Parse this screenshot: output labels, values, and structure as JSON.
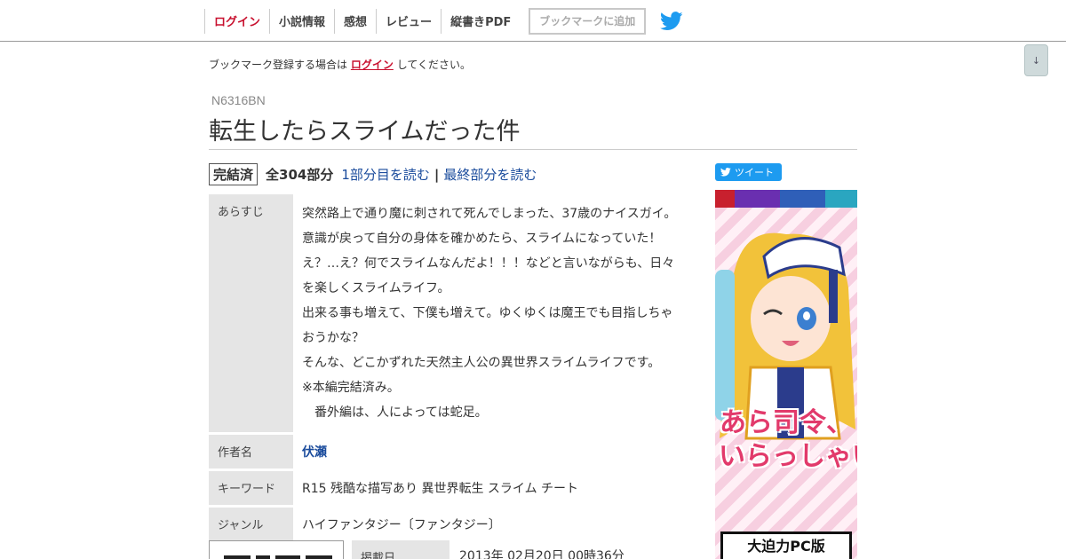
{
  "nav": {
    "items": [
      {
        "label": "ログイン",
        "kind": "login"
      },
      {
        "label": "小説情報"
      },
      {
        "label": "感想"
      },
      {
        "label": "レビュー"
      },
      {
        "label": "縦書きPDF"
      }
    ],
    "bookmark_label": "ブックマークに追加",
    "twitter_icon": "twitter-bird-icon",
    "twitter_color": "#1d9bf0"
  },
  "scroll_button": "↓",
  "notice": {
    "before": "ブックマーク登録する場合は",
    "link": "ログイン",
    "after": "してください。"
  },
  "novel": {
    "ncode": "N6316BN",
    "title": "転生したらスライムだった件",
    "status": "完結済",
    "total": "全304部分",
    "read_first": "1部分目を読む",
    "separator": "|",
    "read_last": "最終部分を読む"
  },
  "info": {
    "summary_label": "あらすじ",
    "summary_lines": [
      "突然路上で通り魔に刺されて死んでしまった、37歳のナイスガイ。",
      "意識が戻って自分の身体を確かめたら、スライムになっていた！",
      "え？…え？何でスライムなんだよ！！！などと言いながらも、日々",
      "を楽しくスライムライフ。",
      "出来る事も増えて、下僕も増えて。ゆくゆくは魔王でも目指しちゃ",
      "おうかな？",
      "そんな、どこかずれた天然主人公の異世界スライムライフです。",
      "※本編完結済み。",
      "　番外編は、人によっては蛇足。"
    ],
    "author_label": "作者名",
    "author": "伏瀬",
    "keyword_label": "キーワード",
    "keywords": "R15 残酷な描写あり 異世界転生  スライム チート",
    "genre_label": "ジャンル",
    "genre": "ハイファンタジー〔ファンタジー〕",
    "published_label": "掲載日",
    "published": "2013年 02月20日 00時36分"
  },
  "sidebar": {
    "tweet_label": "ツイート",
    "ad": {
      "headline_1": "あら司令、",
      "headline_2": "いらっしゃい",
      "promo": "大迫力PC版",
      "stripe_colors": [
        "#c8202e",
        "#6a2fb0",
        "#2f5fb8",
        "#2aa6c0"
      ]
    }
  }
}
